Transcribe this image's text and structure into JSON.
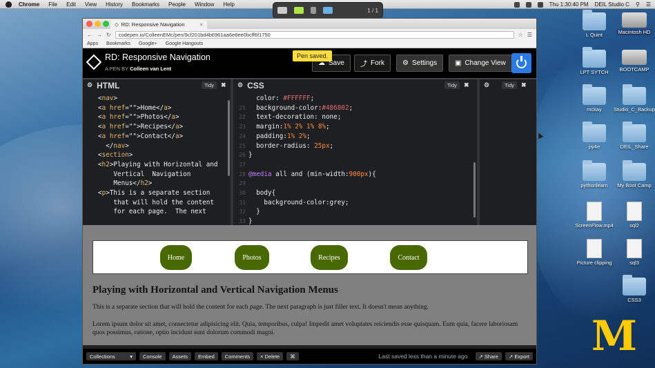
{
  "menubar": {
    "app": "Chrome",
    "menus": [
      "File",
      "Edit",
      "View",
      "History",
      "Bookmarks",
      "People",
      "Window",
      "Help"
    ],
    "clock": "Thu 1:30:40 PM",
    "user": "DEIL Studio C"
  },
  "annotation_toolbar": {
    "page": "1 / 1"
  },
  "browser": {
    "tab_title": "RD: Responsive Navigation",
    "url": "codepen.io/ColleenEMc/pen/9cf201bd4b6961aa6e8ee0bcff6f1750",
    "bookmarks": [
      "Apps",
      "Bookmarks",
      "Google+",
      "Google Hangouts"
    ]
  },
  "codepen": {
    "title": "RD: Responsive Navigation",
    "by_prefix": "A PEN BY",
    "author": "Colleen van Lent",
    "toast": "Pen saved.",
    "buttons": {
      "save": "Save",
      "fork": "Fork",
      "settings": "Settings",
      "change_view": "Change View"
    }
  },
  "html_editor": {
    "title": "HTML",
    "tidy": "Tidy",
    "lines": [
      {
        "n": "",
        "text": ""
      },
      {
        "n": "",
        "text": "<nav>"
      },
      {
        "n": "",
        "text": "<a href=\"\">Home</a>"
      },
      {
        "n": "",
        "text": "<a href=\"\">Photos</a>"
      },
      {
        "n": "",
        "text": "<a href=\"\">Recipes</a>"
      },
      {
        "n": "",
        "text": "<a href=\"\">Contact</a>"
      },
      {
        "n": "",
        "text": "  </nav>"
      },
      {
        "n": "",
        "text": "<section>"
      },
      {
        "n": "",
        "text": "<h2>Playing with Horizontal and"
      },
      {
        "n": "",
        "text": "    Vertical  Navigation"
      },
      {
        "n": "",
        "text": "    Menus</h2>"
      },
      {
        "n": "",
        "text": "<p>This is a separate section"
      },
      {
        "n": "",
        "text": "    that will hold the content"
      },
      {
        "n": "",
        "text": "    for each page.  The next"
      }
    ]
  },
  "css_editor": {
    "title": "CSS",
    "tidy": "Tidy",
    "lines": [
      {
        "n": "",
        "text": "  color: #FFFFFF;"
      },
      {
        "n": "21",
        "text": "  background-color:#486802;"
      },
      {
        "n": "22",
        "text": "  text-decoration: none;"
      },
      {
        "n": "23",
        "text": "  margin:1% 2% 1% 8%;"
      },
      {
        "n": "24",
        "text": "  padding:1% 2%;"
      },
      {
        "n": "25",
        "text": "  border-radius: 25px;"
      },
      {
        "n": "26",
        "text": "}"
      },
      {
        "n": "27",
        "text": ""
      },
      {
        "n": "28",
        "text": "@media all and (min-width:900px){"
      },
      {
        "n": "29",
        "text": ""
      },
      {
        "n": "30",
        "text": "  body{"
      },
      {
        "n": "31",
        "text": "    background-color:grey;"
      },
      {
        "n": "32",
        "text": "  }"
      },
      {
        "n": "33",
        "text": "}"
      }
    ]
  },
  "js_editor": {
    "tidy": "Tidy"
  },
  "preview": {
    "nav": [
      "Home",
      "Photos",
      "Recipes",
      "Contact"
    ],
    "heading": "Playing with Horizontal and Vertical Navigation Menus",
    "p1": "This is a separate section that will hold the content for each page. The next paragraph is just filler text. It doesn't mean anything.",
    "p2": "Lorem ipsum dolor sit amet, consectetur adipisicing elit. Quia, temporibus, culpa! Impedit amet voluptates reiciendis esse quisquam. Eum quia, facere laboriosam quos possimus, ratione, optio incidunt sunt dolorum commodi magni.",
    "nav_color": "#486802",
    "bg_color": "#808080"
  },
  "footer": {
    "collections": "Collections",
    "buttons": [
      "Console",
      "Assets",
      "Embed",
      "Comments",
      "× Delete",
      "⌘"
    ],
    "saved": "Last saved less than a minute ago",
    "share": "Share",
    "export": "Export"
  },
  "desktop_icons": [
    {
      "label": "L Quint",
      "kind": "folder"
    },
    {
      "label": "Macintosh HD",
      "kind": "hd"
    },
    {
      "label": "LPT SYTCH",
      "kind": "folder"
    },
    {
      "label": "BOOTCAMP",
      "kind": "hd"
    },
    {
      "label": "mckay",
      "kind": "folder"
    },
    {
      "label": "Studio_C_Backup",
      "kind": "folder"
    },
    {
      "label": "py4e",
      "kind": "folder"
    },
    {
      "label": "DEIL_Share",
      "kind": "folder"
    },
    {
      "label": "pythonlearn",
      "kind": "folder"
    },
    {
      "label": "My Boot Camp",
      "kind": "folder"
    },
    {
      "label": "ScreenFlow.mp4",
      "kind": "doc"
    },
    {
      "label": "sql2",
      "kind": "doc"
    },
    {
      "label": "Picture clipping",
      "kind": "doc"
    },
    {
      "label": "sql3",
      "kind": "doc"
    },
    {
      "label": "CSS3",
      "kind": "folder"
    }
  ]
}
